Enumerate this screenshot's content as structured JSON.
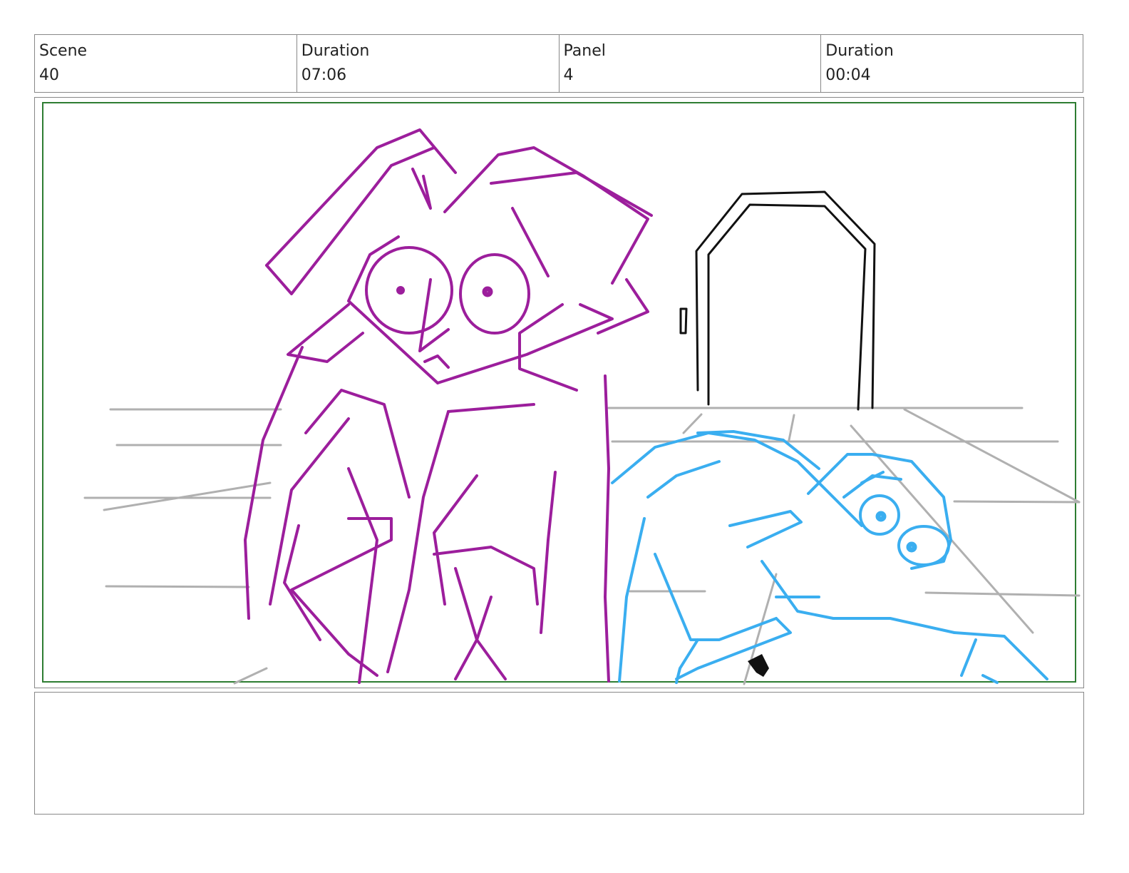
{
  "header": {
    "scene_label": "Scene",
    "scene_value": "40",
    "duration_label": "Duration",
    "duration_value": "07:06",
    "panel_label": "Panel",
    "panel_value": "4",
    "panel_duration_label": "Duration",
    "panel_duration_value": "00:04"
  },
  "panel": {
    "safe_frame_color": "#2e7d32",
    "girl_color": "#9c1e9c",
    "boy_color": "#3aaef0",
    "background_color": "#b0b0b0",
    "door_color": "#111111"
  },
  "notes": {
    "text": ""
  }
}
